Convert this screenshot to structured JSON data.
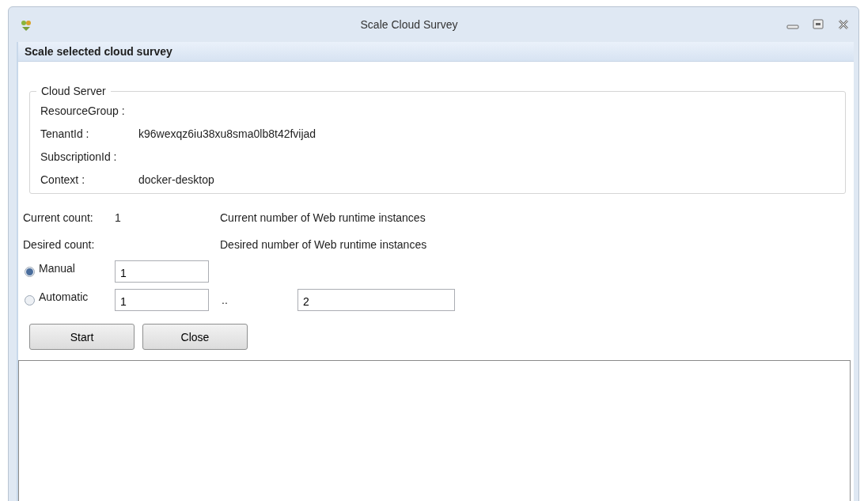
{
  "window": {
    "title": "Scale Cloud Survey"
  },
  "header": "Scale selected cloud survey",
  "cloud_server": {
    "legend": "Cloud Server",
    "fields": [
      {
        "label": "ResourceGroup :"
      },
      {
        "label": "TenantId :",
        "value": "k96wexqz6iu38xu8sma0lb8t42fvijad"
      },
      {
        "label": "SubscriptionId :"
      },
      {
        "label": "Context :",
        "value": "docker-desktop"
      }
    ]
  },
  "current_count": {
    "label": "Current count:",
    "value": "1",
    "description": "Current number of Web runtime instances"
  },
  "desired_count": {
    "label": "Desired count:",
    "description": "Desired number of Web runtime instances"
  },
  "modes": [
    {
      "label": "Manual",
      "selected": true,
      "values": [
        "1"
      ]
    },
    {
      "label": "Automatic",
      "selected": false,
      "values": [
        "1",
        "2"
      ],
      "separator": ".."
    }
  ],
  "buttons": [
    "Start",
    "Close"
  ]
}
